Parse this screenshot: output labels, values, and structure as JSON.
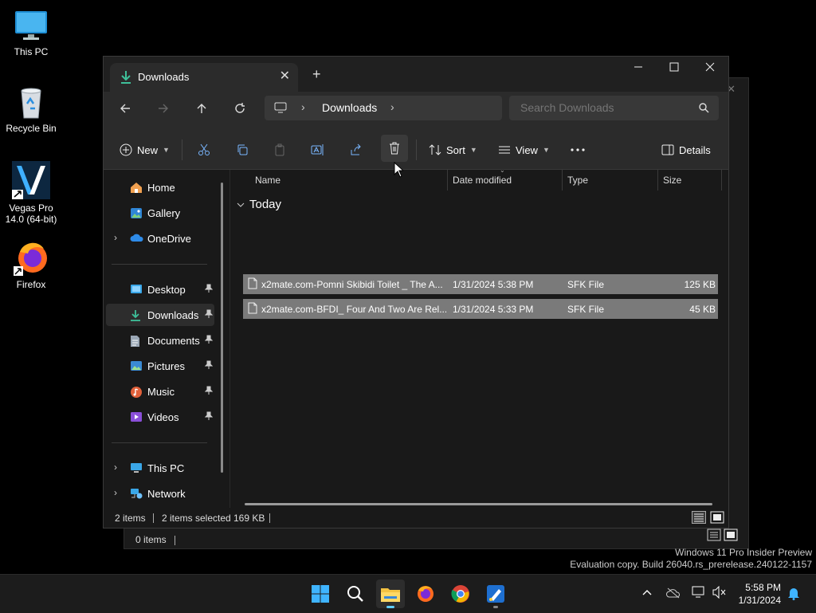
{
  "desktop": {
    "icons": [
      {
        "label": "This PC"
      },
      {
        "label": "Recycle Bin"
      },
      {
        "label": "Vegas Pro 14.0 (64-bit)"
      },
      {
        "label": "Firefox"
      }
    ]
  },
  "bg_window": {
    "status_items": "0 items"
  },
  "explorer": {
    "tab_title": "Downloads",
    "new_tab": "+",
    "address": {
      "location": "Downloads"
    },
    "search": {
      "placeholder": "Search Downloads"
    },
    "toolbar": {
      "new_label": "New",
      "sort_label": "Sort",
      "view_label": "View",
      "details_label": "Details"
    },
    "sidebar": {
      "items": [
        {
          "label": "Home"
        },
        {
          "label": "Gallery"
        },
        {
          "label": "OneDrive"
        },
        {
          "label": "Desktop"
        },
        {
          "label": "Downloads"
        },
        {
          "label": "Documents"
        },
        {
          "label": "Pictures"
        },
        {
          "label": "Music"
        },
        {
          "label": "Videos"
        },
        {
          "label": "This PC"
        },
        {
          "label": "Network"
        }
      ]
    },
    "columns": {
      "name": "Name",
      "date": "Date modified",
      "type": "Type",
      "size": "Size"
    },
    "group_label": "Today",
    "files": [
      {
        "name": "x2mate.com-Pomni Skibidi Toilet _ The A...",
        "date": "1/31/2024 5:38 PM",
        "type": "SFK File",
        "size": "125 KB"
      },
      {
        "name": "x2mate.com-BFDI_ Four And Two Are Rel...",
        "date": "1/31/2024 5:33 PM",
        "type": "SFK File",
        "size": "45 KB"
      }
    ],
    "status": {
      "items": "2 items",
      "selected": "2 items selected",
      "size": "169 KB"
    }
  },
  "watermark": {
    "line1": "Windows 11 Pro Insider Preview",
    "line2": "Evaluation copy. Build 26040.rs_prerelease.240122-1157"
  },
  "taskbar": {
    "time": "5:58 PM",
    "date": "1/31/2024"
  },
  "colors": {
    "accent": "#60cdff",
    "selection": "#7a7a7a",
    "window_bg": "#191919"
  }
}
